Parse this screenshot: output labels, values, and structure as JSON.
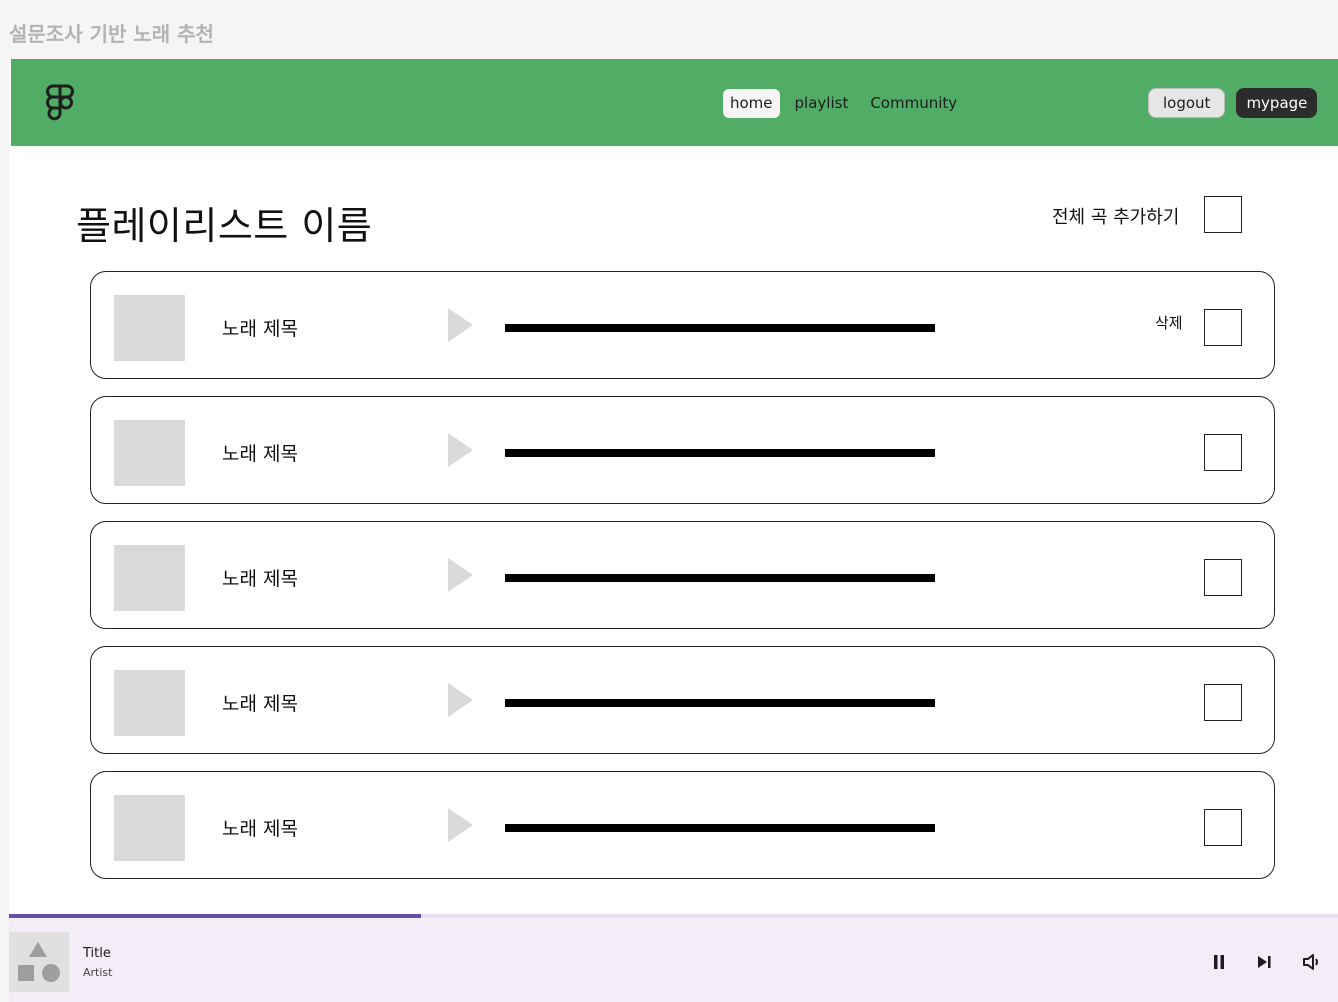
{
  "frame": {
    "title": "설문조사 기반 노래 추천"
  },
  "nav": {
    "links": [
      {
        "label": "home",
        "active": true
      },
      {
        "label": "playlist",
        "active": false
      },
      {
        "label": "Community",
        "active": false
      }
    ],
    "logout_label": "logout",
    "mypage_label": "mypage",
    "brand_color": "#51ad65"
  },
  "playlist": {
    "title": "플레이리스트 이름",
    "add_all_label": "전체 곡 추가하기",
    "delete_label": "삭제",
    "songs": [
      {
        "title": "노래 제목",
        "checked": false
      },
      {
        "title": "노래 제목",
        "checked": false
      },
      {
        "title": "노래 제목",
        "checked": false
      },
      {
        "title": "노래 제목",
        "checked": false
      },
      {
        "title": "노래 제목",
        "checked": false
      }
    ]
  },
  "player": {
    "title": "Title",
    "artist": "Artist",
    "progress": 0.31,
    "icons": [
      "pause-icon",
      "skip-next-icon",
      "volume-icon"
    ]
  }
}
